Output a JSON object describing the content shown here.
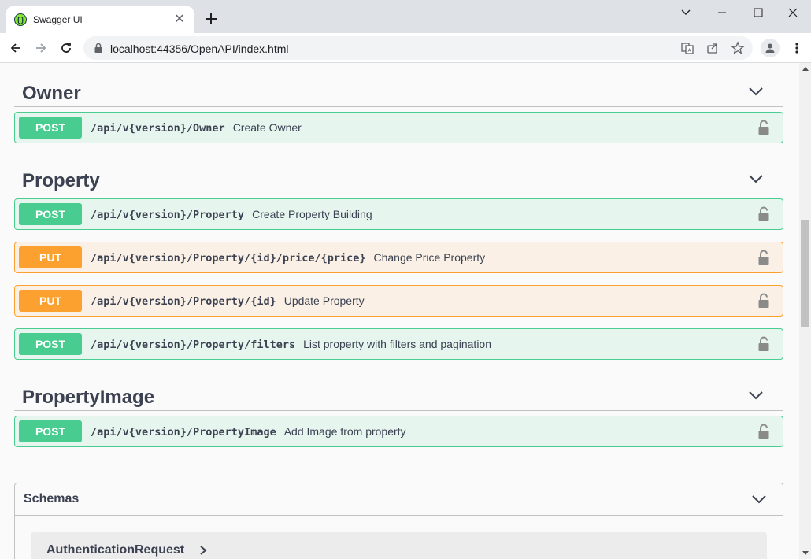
{
  "browser": {
    "tab_title": "Swagger UI",
    "url": "localhost:44356/OpenAPI/index.html"
  },
  "sections": [
    {
      "name": "Owner",
      "operations": [
        {
          "method": "POST",
          "path": "/api/v{version}/Owner",
          "summary": "Create Owner"
        }
      ]
    },
    {
      "name": "Property",
      "operations": [
        {
          "method": "POST",
          "path": "/api/v{version}/Property",
          "summary": "Create Property Building"
        },
        {
          "method": "PUT",
          "path": "/api/v{version}/Property/{id}/price/{price}",
          "summary": "Change Price Property"
        },
        {
          "method": "PUT",
          "path": "/api/v{version}/Property/{id}",
          "summary": "Update Property"
        },
        {
          "method": "POST",
          "path": "/api/v{version}/Property/filters",
          "summary": "List property with filters and pagination"
        }
      ]
    },
    {
      "name": "PropertyImage",
      "operations": [
        {
          "method": "POST",
          "path": "/api/v{version}/PropertyImage",
          "summary": "Add Image from property"
        }
      ]
    }
  ],
  "schemas": {
    "title": "Schemas",
    "models": [
      "AuthenticationRequest"
    ]
  },
  "colors": {
    "post": "#49cc90",
    "put": "#fca130",
    "text": "#3b4151"
  }
}
